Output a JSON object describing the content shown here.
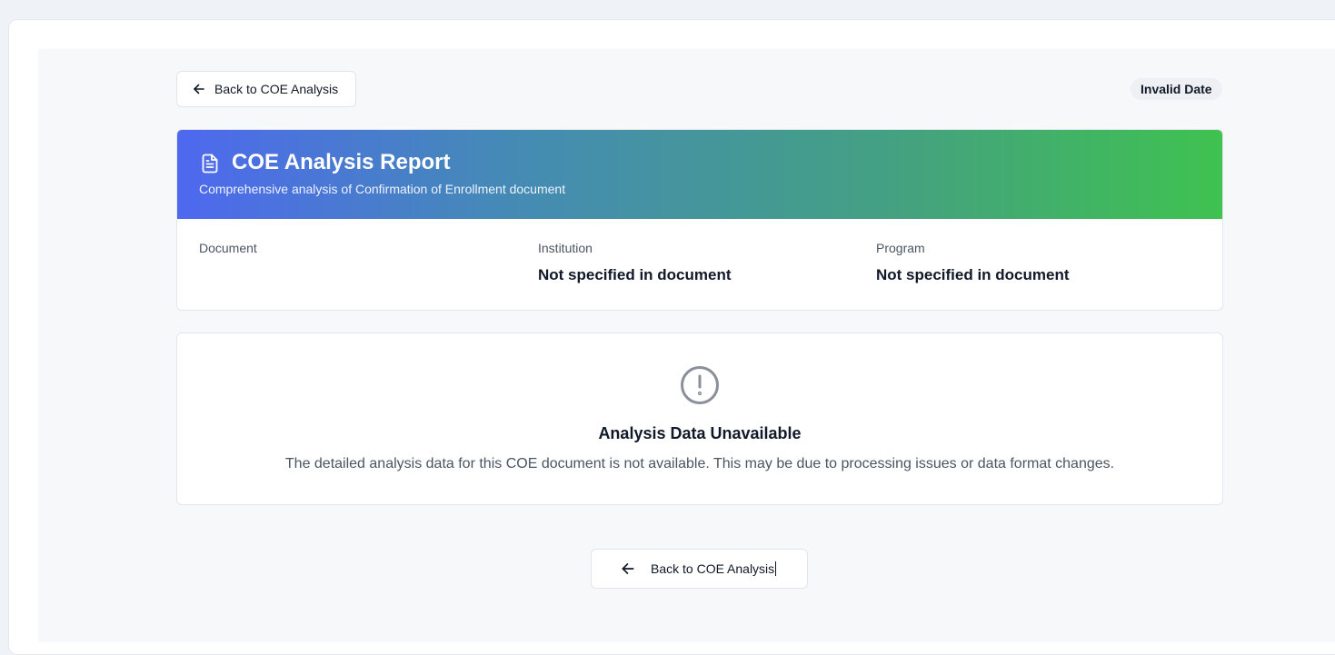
{
  "top_back_button": {
    "label": "Back to COE Analysis",
    "icon": "arrow-left-icon"
  },
  "date_badge": "Invalid Date",
  "report": {
    "icon": "document-icon",
    "title": "COE Analysis Report",
    "subtitle": "Comprehensive analysis of Confirmation of Enrollment document",
    "gradient_colors": [
      "#4e68ef",
      "#3fc250"
    ],
    "fields": [
      {
        "label": "Document",
        "value": ""
      },
      {
        "label": "Institution",
        "value": "Not specified in document"
      },
      {
        "label": "Program",
        "value": "Not specified in document"
      }
    ]
  },
  "notice": {
    "icon": "exclamation-circle-icon",
    "title": "Analysis Data Unavailable",
    "message": "The detailed analysis data for this COE document is not available. This may be due to processing issues or data format changes."
  },
  "bottom_back_button": {
    "label": "Back to COE Analysis",
    "icon": "arrow-left-icon"
  }
}
